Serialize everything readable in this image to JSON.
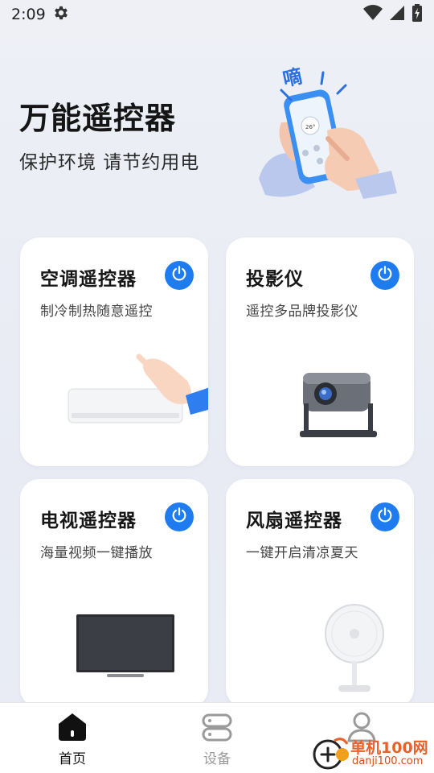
{
  "status_bar": {
    "time": "2:09",
    "icons": [
      "settings-gear-icon",
      "wifi-icon",
      "cellular-signal-icon",
      "battery-charging-icon"
    ]
  },
  "header": {
    "title": "万能遥控器",
    "subtitle": "保护环境 请节约用电",
    "illustration_text": "嘀"
  },
  "cards": [
    {
      "title": "空调遥控器",
      "description": "制冷制热随意遥控",
      "icon": "air-conditioner-image"
    },
    {
      "title": "投影仪",
      "description": "遥控多品牌投影仪",
      "icon": "projector-image"
    },
    {
      "title": "电视遥控器",
      "description": "海量视频一键播放",
      "icon": "tv-image"
    },
    {
      "title": "风扇遥控器",
      "description": "一键开启清凉夏天",
      "icon": "fan-image"
    }
  ],
  "bottom_nav": {
    "items": [
      {
        "label": "首页",
        "icon": "home-icon",
        "active": true
      },
      {
        "label": "设备",
        "icon": "device-icon",
        "active": false
      },
      {
        "label": "",
        "icon": "profile-icon",
        "active": false
      }
    ]
  },
  "watermark": {
    "main": "单机100网",
    "sub": "danji100.com"
  },
  "colors": {
    "accent": "#1f7cf0",
    "background": "#eceef5",
    "card": "#ffffff",
    "nav_active": "#111111",
    "nav_inactive": "#9a9a9a",
    "watermark": "#e8612a"
  }
}
